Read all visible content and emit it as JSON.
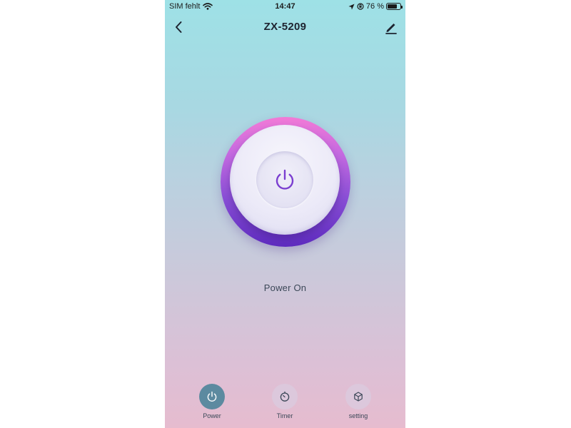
{
  "status_bar": {
    "carrier": "SIM fehlt",
    "time": "14:47",
    "battery_percent": "76 %",
    "battery_level": 0.76
  },
  "nav": {
    "title": "ZX-5209"
  },
  "power": {
    "status": "Power On",
    "state": "on"
  },
  "tabs": [
    {
      "label": "Power",
      "icon": "power-icon",
      "active": true
    },
    {
      "label": "Timer",
      "icon": "timer-icon",
      "active": false
    },
    {
      "label": "setting",
      "icon": "cube-icon",
      "active": false
    }
  ],
  "colors": {
    "accent_purple": "#7b3fd0",
    "active_tab": "#5c8aa0",
    "gradient_top": "#9ee1e6",
    "gradient_bottom": "#e6bccf"
  }
}
